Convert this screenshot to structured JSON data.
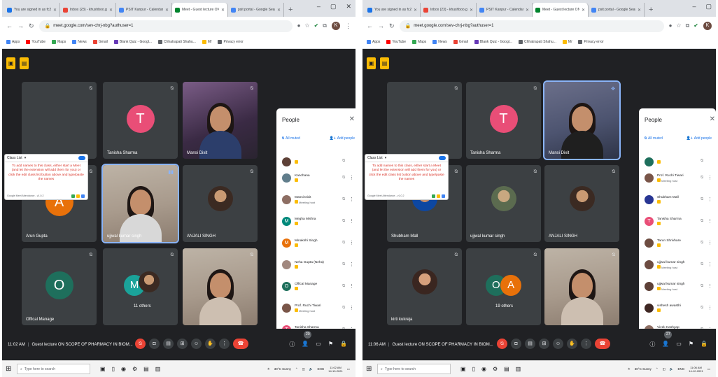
{
  "left": {
    "tabs": [
      {
        "title": "You are signed in as fc22063",
        "color": "#1a73e8"
      },
      {
        "title": "Inbox (23) - khushboo.gaur@pr",
        "color": "#ea4335"
      },
      {
        "title": "PSIT Kanpur - Calendar - Week",
        "color": "#4285f4"
      },
      {
        "title": "Meet - Guest lecture ON SC",
        "color": "#00832d",
        "active": true
      },
      {
        "title": "psit portal - Google Search",
        "color": "#4285f4"
      }
    ],
    "url": "meet.google.com/sev-chrj-nbg?authuser=1",
    "bookmarks": [
      "Apps",
      "YouTube",
      "Maps",
      "News",
      "Gmail",
      "Blank Quiz - Googl...",
      "Chhatrapati Shahu...",
      "M/",
      "Privacy error"
    ],
    "class_list": {
      "title": "Class List",
      "message": "To add names to this class, either start a Meet (and let the extension will add them for you) or click the edit class list button above and type/paste the names",
      "footer": "Google Meet Attendance - v1.0.2"
    },
    "tiles": [
      {
        "name": "",
        "type": "blank"
      },
      {
        "name": "Tanisha Sharma",
        "initial": "T",
        "color": "#e94e77"
      },
      {
        "name": "Mansi Dixit",
        "type": "video"
      },
      {
        "name": "Arun Gupta",
        "initial": "A",
        "color": "#e8710a"
      },
      {
        "name": "ujjwal kumar singh",
        "type": "video"
      },
      {
        "name": "ANJALI SINGH",
        "type": "photo"
      },
      {
        "name": "Offical Manage",
        "initial": "O",
        "color": "#1e6f5c"
      },
      {
        "name": "11 others",
        "initial": "M",
        "color": "#1aa39a"
      },
      {
        "name": "",
        "type": "video"
      }
    ],
    "people": {
      "header": "People",
      "all_muted": "All muted",
      "add_people": "Add people",
      "list": [
        {
          "name": "",
          "sub": "",
          "color": "#5d4037"
        },
        {
          "name": "Kanchana",
          "sub": "",
          "color": "#607d8b"
        },
        {
          "name": "Mansi Dixit",
          "sub": "Meeting host",
          "color": "#8d6e63"
        },
        {
          "name": "Megha Mishra",
          "sub": "",
          "color": "#00897b"
        },
        {
          "name": "Minakshi Singh",
          "sub": "",
          "color": "#e8710a"
        },
        {
          "name": "Neha Gupta (Neha)",
          "sub": "",
          "color": "#a1887f"
        },
        {
          "name": "Offical Manage",
          "sub": "",
          "color": "#1e6f5c"
        },
        {
          "name": "Prof. Ruchi Tiwari",
          "sub": "Meeting host",
          "color": "#795548"
        },
        {
          "name": "Tanisha Sharma",
          "sub": "",
          "color": "#e94e77"
        },
        {
          "name": "ujjwal kumar singh",
          "sub": "",
          "color": "#6d4c41"
        }
      ]
    },
    "meeting_time": "11:02 AM",
    "meeting_title": "Guest lecture ON SCOPE OF PHARMACY IN BIOM...",
    "participant_count": "20",
    "weather": "30°C Sunny",
    "clock_time": "11:02 AM",
    "clock_date": "14-10-2021",
    "lang": "ENG",
    "search_placeholder": "Type here to search"
  },
  "right": {
    "tabs": [
      {
        "title": "You are signed in as fc22063",
        "color": "#1a73e8"
      },
      {
        "title": "Inbox (23) - khushboo.gaur@pr",
        "color": "#ea4335"
      },
      {
        "title": "PSIT Kanpur - Calendar - Week",
        "color": "#4285f4"
      },
      {
        "title": "Meet - Guest lecture ON SC",
        "color": "#00832d",
        "active": true
      },
      {
        "title": "psit portal - Google Search",
        "color": "#4285f4"
      }
    ],
    "url": "meet.google.com/sev-chrj-nbg?authuser=1",
    "bookmarks": [
      "Apps",
      "YouTube",
      "Maps",
      "News",
      "Gmail",
      "Blank Quiz - Googl...",
      "Chhatrapati Shahu...",
      "M/",
      "Privacy error"
    ],
    "class_list": {
      "title": "Class List",
      "message": "To add names to this class, either start a Meet (and let the extension will add them for you) or click the edit class list button above and type/paste the names",
      "footer": "Google Meet Attendance - v1.0.2"
    },
    "tiles": [
      {
        "name": "",
        "type": "blank"
      },
      {
        "name": "Tanisha Sharma",
        "initial": "T",
        "color": "#e94e77"
      },
      {
        "name": "Mansi Dixit",
        "type": "video"
      },
      {
        "name": "Shubham Mall",
        "type": "photo"
      },
      {
        "name": "ujjwal kumar singh",
        "type": "photo"
      },
      {
        "name": "ANJALI SINGH",
        "type": "photo"
      },
      {
        "name": "kirti kukreja",
        "type": "photo"
      },
      {
        "name": "19 others",
        "initial": "O",
        "color": "#1e6f5c"
      },
      {
        "name": "",
        "type": "video"
      }
    ],
    "people": {
      "header": "People",
      "all_muted": "All muted",
      "add_people": "Add people",
      "list": [
        {
          "name": "",
          "sub": "",
          "color": "#1e6f5c"
        },
        {
          "name": "Prof. Ruchi Tiwari",
          "sub": "Meeting host",
          "color": "#795548"
        },
        {
          "name": "Shubham Mall",
          "sub": "",
          "color": "#283593"
        },
        {
          "name": "Tanisha Sharma",
          "sub": "",
          "color": "#e94e77"
        },
        {
          "name": "Tarun Shrivhare",
          "sub": "",
          "color": "#6d4c41"
        },
        {
          "name": "ujjwal kumar singh",
          "sub": "Meeting host",
          "color": "#6d4c41"
        },
        {
          "name": "ujjwal kumar singh",
          "sub": "Meeting host",
          "color": "#5d4037"
        },
        {
          "name": "vishesh awasthi",
          "sub": "",
          "color": "#3e2723"
        },
        {
          "name": "Vivek Kashyap",
          "sub": "",
          "color": "#8d6e63"
        }
      ]
    },
    "meeting_time": "11:06 AM",
    "meeting_title": "Guest lecture ON SCOPE OF PHARMACY IN BIOM...",
    "participant_count": "27",
    "weather": "30°C Sunny",
    "clock_time": "11:06 AM",
    "clock_date": "14-10-2021",
    "lang": "ENG",
    "search_placeholder": "Type here to search"
  }
}
